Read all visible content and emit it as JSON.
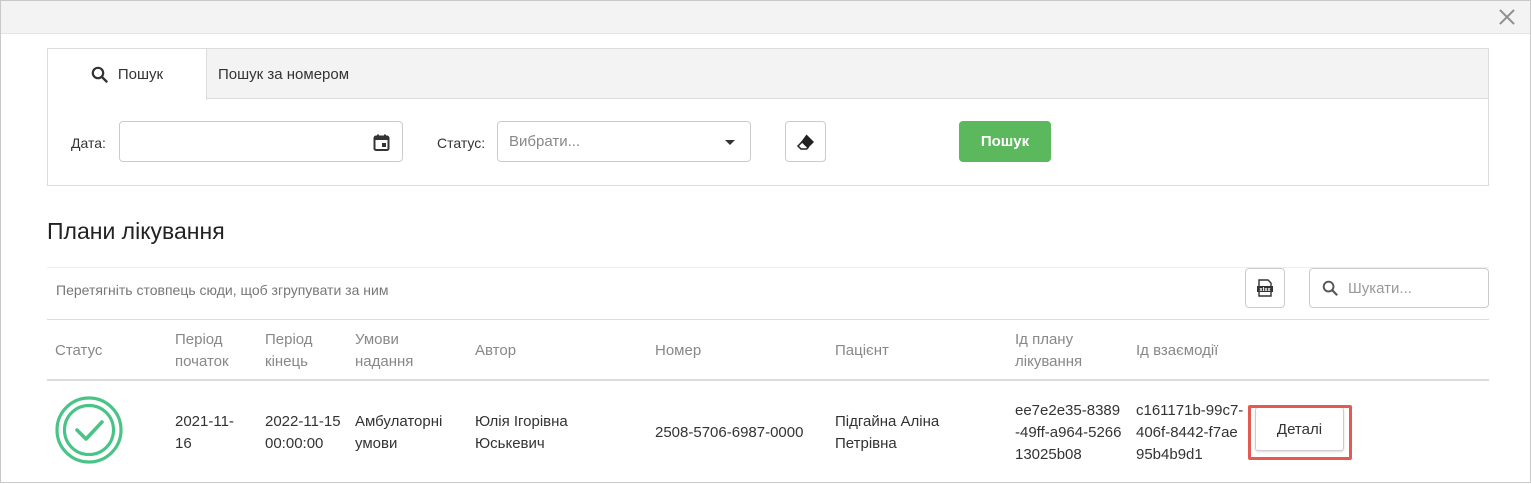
{
  "search": {
    "tabs": [
      {
        "label": "Пошук",
        "icon": "search-icon"
      },
      {
        "label": "Пошук за номером"
      }
    ],
    "date_label": "Дата:",
    "date_value": "",
    "status_label": "Статус:",
    "status_placeholder": "Вибрати...",
    "search_button": "Пошук"
  },
  "section_title": "Плани лікування",
  "grid": {
    "group_hint": "Перетягніть стовпець сюди, щоб згрупувати за ним",
    "search_placeholder": "Шукати...",
    "columns": [
      "Статус",
      "Період початок",
      "Період кінець",
      "Умови надання",
      "Автор",
      "Номер",
      "Пацієнт",
      "Ід плану лікування",
      "Ід взаємодії"
    ],
    "rows": [
      {
        "status_icon": "check-circle-icon",
        "period_start": "2021-11-16",
        "period_end": "2022-11-15 00:00:00",
        "conditions": "Амбулаторні умови",
        "author": "Юлія Ігорівна Юськевич",
        "number": "2508-5706-6987-0000",
        "patient": "Підгайна Аліна Петрівна",
        "plan_id": "ee7e2e35-8389-49ff-a964-526613025b08",
        "interaction_id": "c161171b-99c7-406f-8442-f7ae95b4b9d1",
        "details_button": "Деталі"
      }
    ]
  },
  "colors": {
    "accent_green": "#5cb85c",
    "status_green": "#4ac486",
    "highlight_red": "#e25a52"
  }
}
